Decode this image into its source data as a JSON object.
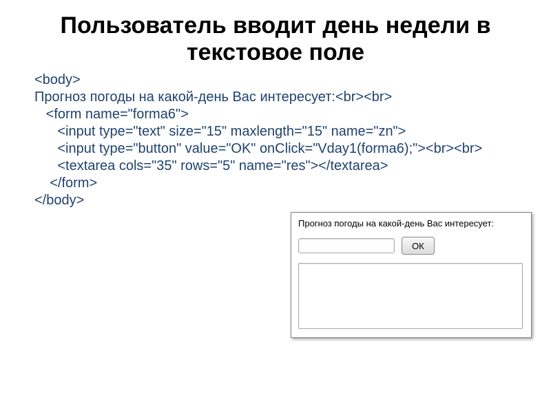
{
  "title": "Пользователь вводит день недели в текстовое поле",
  "code": {
    "l1": "<body>",
    "l2": "Прогноз погоды на какой-день Вас интересует:<br><br>",
    "l3": "   <form name=\"forma6\">",
    "l4": "      <input type=\"text\" size=\"15\" maxlength=\"15\" name=\"zn\">",
    "l5": "      <input type=\"button\" value=\"OK\" onClick=\"Vday1(forma6);\"><br><br>",
    "l6": "      <textarea cols=\"35\" rows=\"5\" name=\"res\"></textarea>",
    "l7": "    </form>",
    "l8": "</body>"
  },
  "demo": {
    "label": "Прогноз погоды на какой-день Вас интересует:",
    "input_value": "",
    "button_label": "ОК",
    "textarea_value": ""
  }
}
